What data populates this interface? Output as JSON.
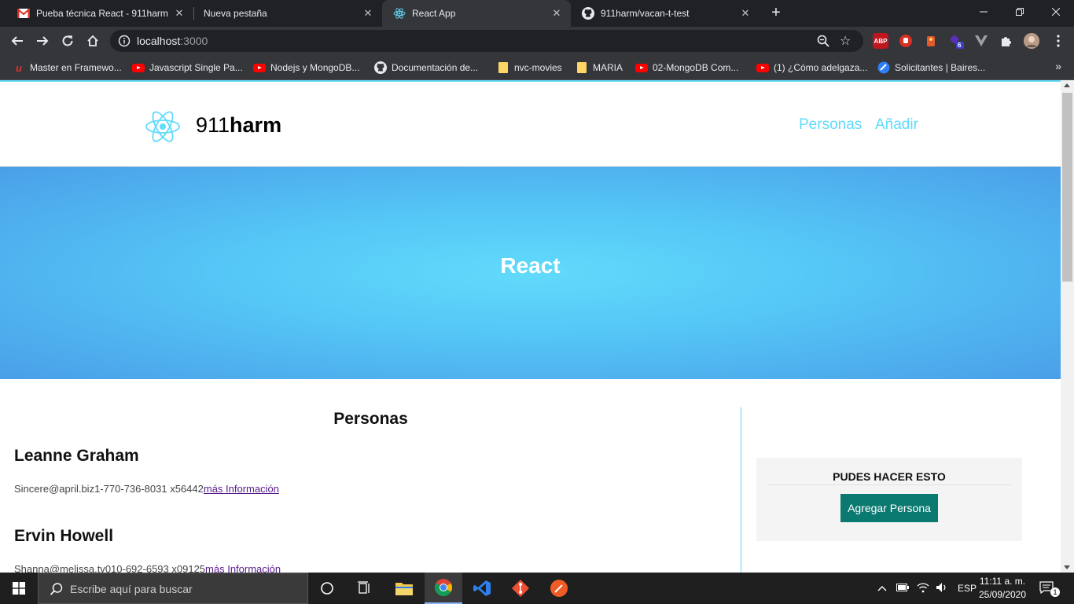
{
  "browser": {
    "tabs": [
      {
        "title": "Pueba técnica React - 911harm@",
        "icon": "gmail-icon",
        "active": false
      },
      {
        "title": "Nueva pestaña",
        "icon": "none",
        "active": false
      },
      {
        "title": "React App",
        "icon": "react-icon",
        "active": true
      },
      {
        "title": "911harm/vacan-t-test",
        "icon": "github-icon",
        "active": false
      }
    ],
    "url_host": "localhost",
    "url_port": ":3000",
    "extensions": [
      {
        "name": "abp-icon",
        "label": "ABP",
        "color": "#c0161e"
      },
      {
        "name": "hand-stop-icon",
        "label": "",
        "color": "#d93025"
      },
      {
        "name": "extension-red-icon",
        "label": "",
        "color": "#e25b2d"
      },
      {
        "name": "extension-badge-icon",
        "label": "6",
        "color": "#5b2fb8"
      }
    ]
  },
  "bookmarks": [
    {
      "label": "Master en Framewo...",
      "icon": "udemy-icon"
    },
    {
      "label": "Javascript Single Pa...",
      "icon": "youtube-icon"
    },
    {
      "label": "Nodejs y MongoDB...",
      "icon": "youtube-icon"
    },
    {
      "label": "Documentación de...",
      "icon": "github-icon"
    },
    {
      "label": "nvc-movies",
      "icon": "folder-icon"
    },
    {
      "label": "MARIA",
      "icon": "folder-icon"
    },
    {
      "label": "02-MongoDB Com...",
      "icon": "youtube-icon"
    },
    {
      "label": "(1) ¿Cómo adelgaza...",
      "icon": "youtube-icon"
    },
    {
      "label": "Solicitantes | Baires...",
      "icon": "bairesdev-icon"
    }
  ],
  "site": {
    "brand_light": "911",
    "brand_bold": "harm",
    "nav": [
      "Personas",
      "Añadir"
    ],
    "hero_title": "React",
    "section_title": "Personas",
    "people": [
      {
        "name": "Leanne Graham",
        "email": "Sincere@april.biz",
        "phone": "1-770-736-8031 x56442",
        "link": "más Información"
      },
      {
        "name": "Ervin Howell",
        "email": "Shanna@melissa.tv",
        "phone": "010-692-6593 x09125",
        "link": "más Información"
      }
    ],
    "sidebar": {
      "title": "PUDES HACER ESTO",
      "button": "Agregar Persona"
    },
    "accent": "#61dafb",
    "button_color": "#0a7a70"
  },
  "taskbar": {
    "search_placeholder": "Escribe aquí para buscar",
    "language": "ESP",
    "time": "11:11 a. m.",
    "date": "25/09/2020",
    "notifications": "1"
  }
}
